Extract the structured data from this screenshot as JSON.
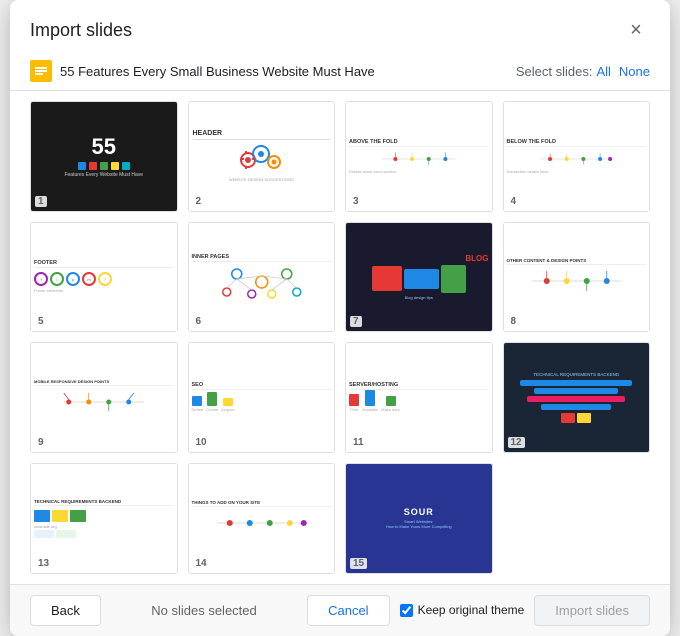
{
  "dialog": {
    "title": "Import slides",
    "close_label": "×"
  },
  "source": {
    "icon_label": "S",
    "title": "55 Features Every Small Business Website Must Have"
  },
  "select_controls": {
    "label": "Select slides:",
    "all_label": "All",
    "none_label": "None"
  },
  "slides": [
    {
      "number": "1",
      "type": "dark-55"
    },
    {
      "number": "2",
      "type": "header-gears"
    },
    {
      "number": "3",
      "type": "above-fold"
    },
    {
      "number": "4",
      "type": "below-fold"
    },
    {
      "number": "5",
      "type": "footer"
    },
    {
      "number": "6",
      "type": "inner-pages"
    },
    {
      "number": "7",
      "type": "blog"
    },
    {
      "number": "8",
      "type": "content-design"
    },
    {
      "number": "9",
      "type": "mobile-responsive"
    },
    {
      "number": "10",
      "type": "seo"
    },
    {
      "number": "11",
      "type": "server-hosting"
    },
    {
      "number": "12",
      "type": "tech-requirements-dark"
    },
    {
      "number": "13",
      "type": "tech-requirements-light"
    },
    {
      "number": "14",
      "type": "things-todo"
    },
    {
      "number": "15",
      "type": "sour"
    }
  ],
  "footer": {
    "back_label": "Back",
    "status_label": "No slides selected",
    "cancel_label": "Cancel",
    "import_label": "Import slides",
    "keep_theme_label": "Keep original theme"
  }
}
